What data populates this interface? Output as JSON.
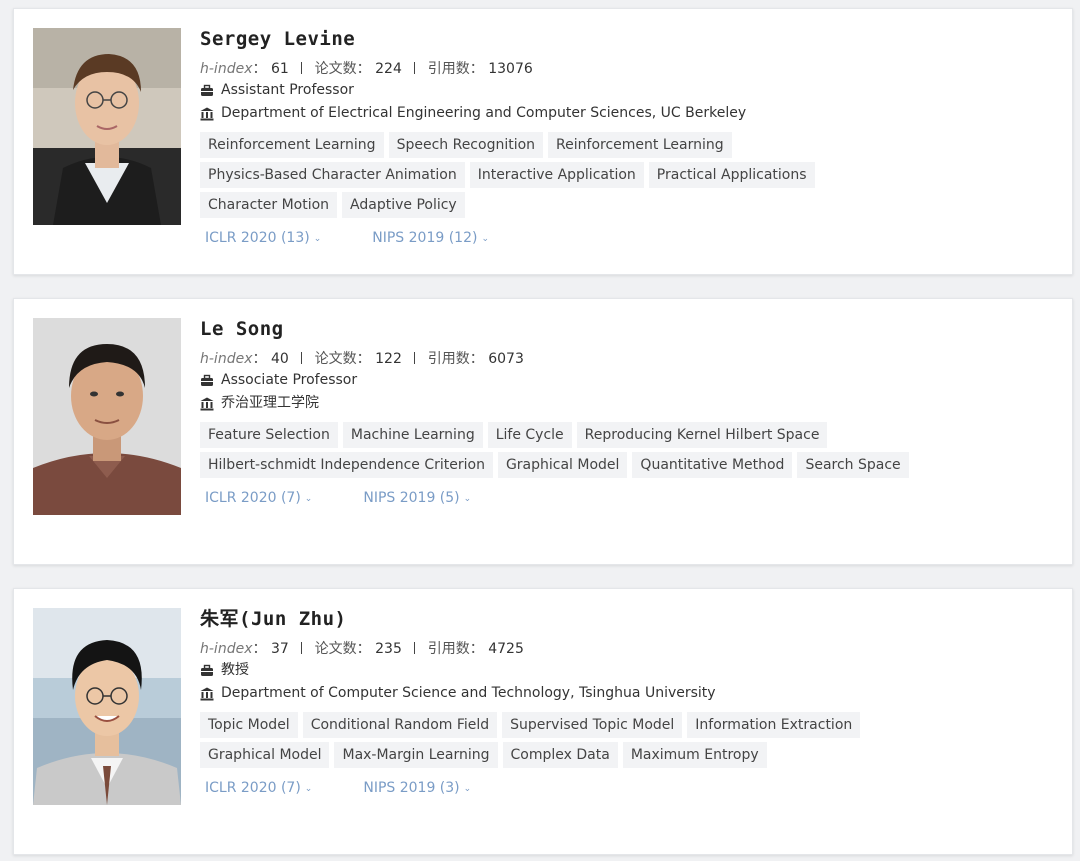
{
  "labels": {
    "hindex": "h-index",
    "papers": "论文数",
    "citations": "引用数",
    "colon": "："
  },
  "icons": {
    "position": "briefcase-icon",
    "org": "institution-icon",
    "venue_toggle": "chevron-down-icon"
  },
  "scholars": [
    {
      "name": "Sergey Levine",
      "hindex": "61",
      "papers": "224",
      "citations": "13076",
      "position": "Assistant Professor",
      "org": "Department of Electrical Engineering and Computer Sciences, UC Berkeley",
      "tags": [
        "Reinforcement Learning",
        "Speech Recognition",
        "Reinforcement Learning",
        "Physics-Based Character Animation",
        "Interactive Application",
        "Practical Applications",
        "Character Motion",
        "Adaptive Policy"
      ],
      "venues": [
        "ICLR 2020 (13)",
        "NIPS 2019 (12)"
      ]
    },
    {
      "name": "Le Song",
      "hindex": "40",
      "papers": "122",
      "citations": "6073",
      "position": "Associate Professor",
      "org": "乔治亚理工学院",
      "tags": [
        "Feature Selection",
        "Machine Learning",
        "Life Cycle",
        "Reproducing Kernel Hilbert Space",
        "Hilbert-schmidt Independence Criterion",
        "Graphical Model",
        "Quantitative Method",
        "Search Space"
      ],
      "venues": [
        "ICLR 2020 (7)",
        "NIPS 2019 (5)"
      ]
    },
    {
      "name": "朱军(Jun Zhu)",
      "hindex": "37",
      "papers": "235",
      "citations": "4725",
      "position": "教授",
      "org": "Department of Computer Science and Technology, Tsinghua University",
      "tags": [
        "Topic Model",
        "Conditional Random Field",
        "Supervised Topic Model",
        "Information Extraction",
        "Graphical Model",
        "Max-Margin Learning",
        "Complex Data",
        "Maximum Entropy"
      ],
      "venues": [
        "ICLR 2020 (7)",
        "NIPS 2019 (3)"
      ]
    }
  ]
}
